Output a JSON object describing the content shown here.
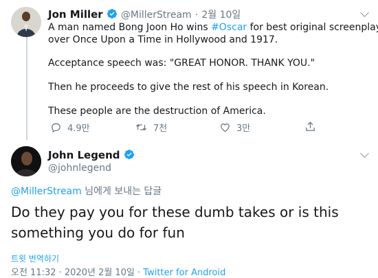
{
  "tweet1": {
    "name": "Jon Miller",
    "handle": "@MillerStream",
    "separator": "·",
    "date": "2월 10일",
    "line1_pre": "A man named Bong Joon Ho wins ",
    "hashtag": "#Oscar",
    "line1_post": " for best original screenplay",
    "line2": "over Once Upon a Time in Hollywood and 1917.",
    "p2": "Acceptance speech was: \"GREAT HONOR. THANK YOU.\"",
    "p3": "Then he proceeds to give the rest of his speech in Korean.",
    "p4": "These people are the destruction of America.",
    "replies": "4.9만",
    "retweets": "7천",
    "likes": "3만"
  },
  "tweet2": {
    "name": "John Legend",
    "handle": "@johnlegend",
    "reply_to_handle": "@MillerStream",
    "reply_to_suffix": " 님에게 보내는 답글",
    "text_line1": "Do they pay you for these dumb takes or is this",
    "text_line2": "something you do for fun",
    "translate": "트윗 번역하기",
    "time": "오전 11:32 · 2020년 2월 10일 · ",
    "source": "Twitter for Android"
  },
  "colors": {
    "accent": "#1da1f2",
    "muted": "#657786",
    "text": "#14171a"
  }
}
